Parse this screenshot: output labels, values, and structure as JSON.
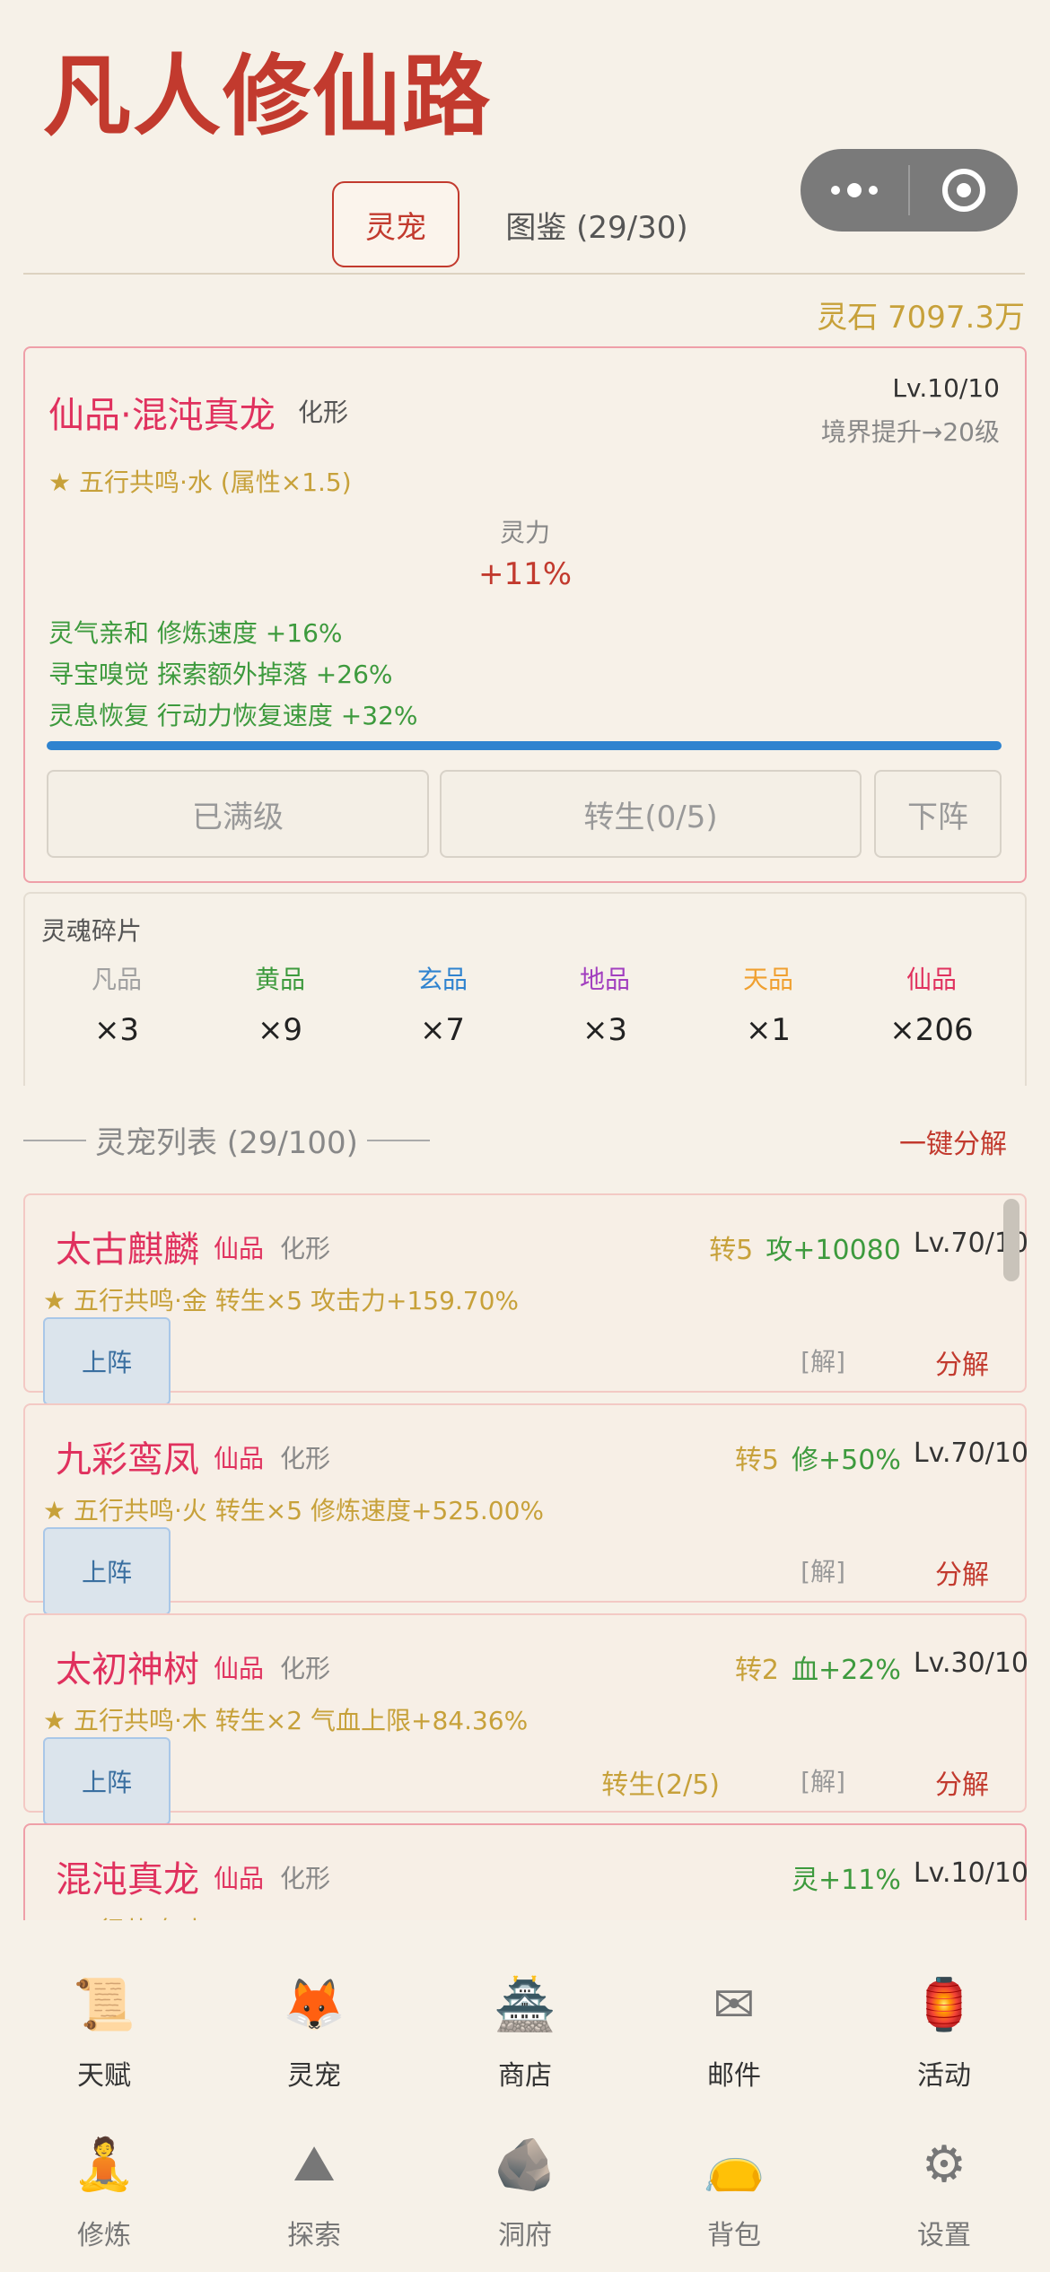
{
  "app": {
    "title": "凡人修仙路"
  },
  "tabs": [
    {
      "label": "灵宠"
    },
    {
      "label": "图鉴 (29/30)"
    }
  ],
  "currency": {
    "label": "灵石 7097.3万"
  },
  "current_pet": {
    "name": "仙品·混沌真龙",
    "tag": "化形",
    "level": "Lv.10/10",
    "realm_note": "境界提升→20级",
    "wuxing": "★ 五行共鸣·水 (属性×1.5)",
    "stat_label": "灵力",
    "stat_value": "+11%",
    "skills": [
      "灵气亲和 修炼速度 +16%",
      "寻宝嗅觉 探索额外掉落 +26%",
      "灵息恢复 行动力恢复速度 +32%"
    ],
    "progress": 1.0,
    "buttons": {
      "maxed": "已满级",
      "rebirth": "转生(0/5)",
      "undeploy": "下阵"
    }
  },
  "fragments": {
    "title": "灵魂碎片",
    "grades": [
      {
        "grade": "凡品",
        "count": "×3",
        "color": "#a0a0a0"
      },
      {
        "grade": "黄品",
        "count": "×9",
        "color": "#3d9a3d"
      },
      {
        "grade": "玄品",
        "count": "×7",
        "color": "#2f83cf"
      },
      {
        "grade": "地品",
        "count": "×3",
        "color": "#a23fbf"
      },
      {
        "grade": "天品",
        "count": "×1",
        "color": "#f0a030"
      },
      {
        "grade": "仙品",
        "count": "×206",
        "color": "#e0315e"
      }
    ]
  },
  "pet_list": {
    "header": "灵宠列表 (29/100)",
    "decompose_all": "一键分解",
    "items": [
      {
        "name": "太古麒麟",
        "grade": "仙品",
        "form": "化形",
        "rebirth": "转5",
        "bonus": "攻+10080",
        "level": "Lv.70/10",
        "desc": "★ 五行共鸣·金  转生×5 攻击力+159.70%",
        "deploy": "上阵",
        "jie": "[解]",
        "fenjie": "分解",
        "zhuansheng": ""
      },
      {
        "name": "九彩鸾凤",
        "grade": "仙品",
        "form": "化形",
        "rebirth": "转5",
        "bonus": "修+50%",
        "level": "Lv.70/10",
        "desc": "★ 五行共鸣·火  转生×5 修炼速度+525.00%",
        "deploy": "上阵",
        "jie": "[解]",
        "fenjie": "分解",
        "zhuansheng": ""
      },
      {
        "name": "太初神树",
        "grade": "仙品",
        "form": "化形",
        "rebirth": "转2",
        "bonus": "血+22%",
        "level": "Lv.30/10",
        "desc": "★ 五行共鸣·木  转生×2 气血上限+84.36%",
        "deploy": "上阵",
        "jie": "[解]",
        "fenjie": "分解",
        "zhuansheng": "转生(2/5)"
      },
      {
        "name": "混沌真龙",
        "grade": "仙品",
        "form": "化形",
        "rebirth": "",
        "bonus": "灵+11%",
        "level": "Lv.10/10",
        "desc": "★ 五行共鸣·水",
        "deploy": "",
        "jie": "",
        "fenjie": "",
        "zhuansheng": ""
      }
    ]
  },
  "nav": {
    "row1": [
      {
        "label": "天赋",
        "icon": "scroll-icon"
      },
      {
        "label": "灵宠",
        "icon": "fox-icon"
      },
      {
        "label": "商店",
        "icon": "pavilion-icon"
      },
      {
        "label": "邮件",
        "icon": "envelope-icon"
      },
      {
        "label": "活动",
        "icon": "lantern-icon"
      }
    ],
    "row2": [
      {
        "label": "修炼",
        "icon": "meditation-icon"
      },
      {
        "label": "探索",
        "icon": "mountain-icon"
      },
      {
        "label": "洞府",
        "icon": "cave-icon"
      },
      {
        "label": "背包",
        "icon": "bag-icon"
      },
      {
        "label": "设置",
        "icon": "gear-icon"
      }
    ]
  }
}
